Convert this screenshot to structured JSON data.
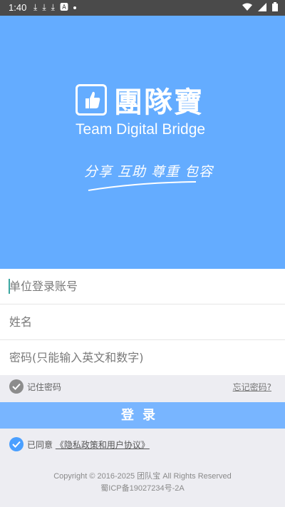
{
  "status_bar": {
    "time": "1:40",
    "icons": [
      "download-icon",
      "download-icon",
      "download-icon",
      "font-icon",
      "dot-icon"
    ],
    "right_icons": [
      "wifi-icon",
      "signal-icon",
      "battery-icon"
    ]
  },
  "hero": {
    "brand_cn": "團隊寶",
    "brand_en": "Team Digital Bridge",
    "slogan": "分享 互助 尊重 包容",
    "bg_color": "#64acff"
  },
  "form": {
    "account_placeholder": "单位登录账号",
    "name_placeholder": "姓名",
    "password_placeholder": "密码(只能输入英文和数字)"
  },
  "remember": {
    "label": "记住密码",
    "forgot": "忘记密码?"
  },
  "login_button": "登录",
  "agreement": {
    "prefix": "已同意",
    "link": "《隐私政策和用户协议》"
  },
  "footer": {
    "copyright": "Copyright © 2016-2025 团队宝 All Rights Reserved",
    "icp": "蜀ICP备19027234号-2A"
  },
  "colors": {
    "accent": "#78b5ff",
    "check_blue": "#4a9fff"
  }
}
